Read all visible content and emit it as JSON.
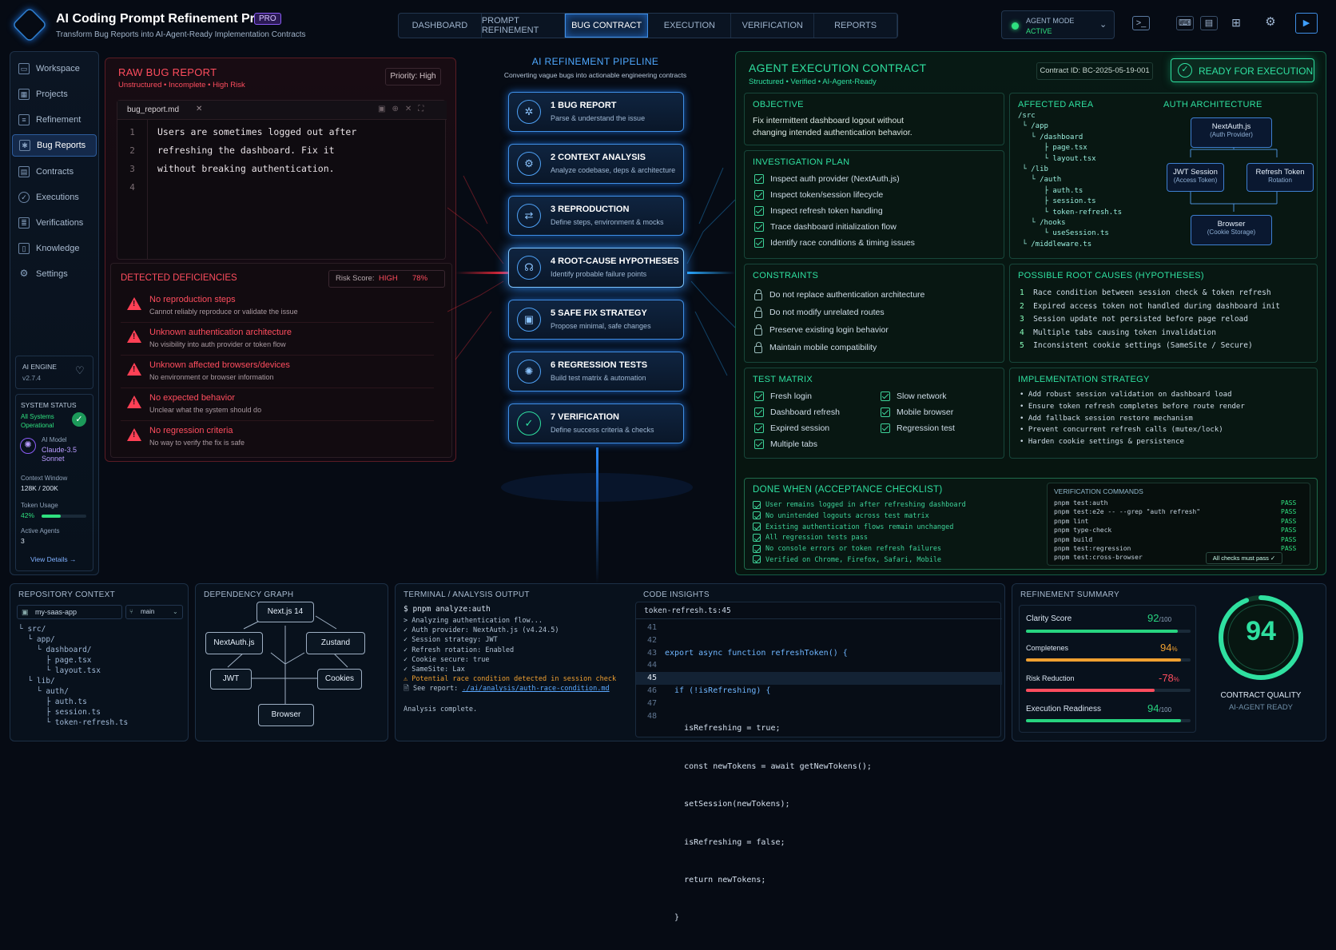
{
  "app": {
    "title": "AI Coding Prompt Refinement Pro",
    "badge": "PRO",
    "subtitle": "Transform Bug Reports into AI-Agent-Ready Implementation Contracts"
  },
  "tabs": [
    "DASHBOARD",
    "PROMPT REFINEMENT",
    "BUG CONTRACT",
    "EXECUTION",
    "VERIFICATION",
    "REPORTS"
  ],
  "agent_mode": {
    "label": "AGENT MODE",
    "status": "ACTIVE"
  },
  "sidebar": {
    "items": [
      "Workspace",
      "Projects",
      "Refinement",
      "Bug Reports",
      "Contracts",
      "Executions",
      "Verifications",
      "Knowledge",
      "Settings"
    ],
    "engine_label": "AI ENGINE",
    "engine_version": "v2.7.4",
    "status_title": "SYSTEM STATUS",
    "status_text": "All Systems Operational",
    "model_label": "AI Model",
    "model_name": "Claude-3.5 Sonnet",
    "ctx_label": "Context Window",
    "ctx_value": "128K / 200K",
    "token_label": "Token Usage",
    "token_value": "42%",
    "token_fraction": 0.42,
    "agents_label": "Active Agents",
    "agents_value": "3",
    "view_details": "View Details →"
  },
  "raw": {
    "title": "RAW BUG REPORT",
    "tags": "Unstructured • Incomplete • High Risk",
    "priority": "Priority: High",
    "filename": "bug_report.md",
    "lines": [
      "Users are sometimes logged out after",
      "refreshing the dashboard. Fix it",
      "without breaking authentication.",
      ""
    ],
    "line_numbers": [
      "1",
      "2",
      "3",
      "4"
    ]
  },
  "deficiencies": {
    "title": "DETECTED DEFICIENCIES",
    "risk_label": "Risk Score:",
    "risk_level": "HIGH",
    "risk_pct": "78%",
    "items": [
      {
        "t": "No reproduction steps",
        "d": "Cannot reliably reproduce or validate the issue"
      },
      {
        "t": "Unknown authentication architecture",
        "d": "No visibility into auth provider or token flow"
      },
      {
        "t": "Unknown affected browsers/devices",
        "d": "No environment or browser information"
      },
      {
        "t": "No expected behavior",
        "d": "Unclear what the system should do"
      },
      {
        "t": "No regression criteria",
        "d": "No way to verify the fix is safe"
      }
    ]
  },
  "pipeline": {
    "title": "AI REFINEMENT PIPELINE",
    "subtitle": "Converting vague bugs into actionable engineering contracts",
    "steps": [
      {
        "n": "1 BUG REPORT",
        "d": "Parse & understand the issue",
        "i": "✲"
      },
      {
        "n": "2 CONTEXT ANALYSIS",
        "d": "Analyze codebase, deps & architecture",
        "i": "⚙"
      },
      {
        "n": "3 REPRODUCTION",
        "d": "Define steps, environment & mocks",
        "i": "⇄"
      },
      {
        "n": "4 ROOT-CAUSE HYPOTHESES",
        "d": "Identify probable failure points",
        "i": "☊"
      },
      {
        "n": "5 SAFE FIX STRATEGY",
        "d": "Propose minimal, safe changes",
        "i": "▣"
      },
      {
        "n": "6 REGRESSION TESTS",
        "d": "Build test matrix & automation",
        "i": "✺"
      },
      {
        "n": "7 VERIFICATION",
        "d": "Define success criteria & checks",
        "i": "✓"
      }
    ]
  },
  "contract": {
    "title": "AGENT EXECUTION CONTRACT",
    "tags": "Structured • Verified • AI-Agent-Ready",
    "id": "Contract ID:  BC-2025-05-19-001",
    "ready": "READY FOR EXECUTION",
    "objective_title": "OBJECTIVE",
    "objective": [
      "Fix intermittent dashboard logout without",
      "changing intended authentication behavior."
    ],
    "plan_title": "INVESTIGATION PLAN",
    "plan": [
      "Inspect auth provider (NextAuth.js)",
      "Inspect token/session lifecycle",
      "Inspect refresh token handling",
      "Trace dashboard initialization flow",
      "Identify race conditions & timing issues"
    ],
    "constraints_title": "CONSTRAINTS",
    "constraints": [
      "Do not replace authentication architecture",
      "Do not modify unrelated routes",
      "Preserve existing login behavior",
      "Maintain mobile compatibility"
    ],
    "matrix_title": "TEST MATRIX",
    "matrix_left": [
      "Fresh login",
      "Dashboard refresh",
      "Expired session",
      "Multiple tabs"
    ],
    "matrix_right": [
      "Slow network",
      "Mobile browser",
      "Regression test"
    ],
    "affected_title": "AFFECTED AREA",
    "affected_tree": "/src\n └ /app\n   └ /dashboard\n      ├ page.tsx\n      └ layout.tsx\n └ /lib\n   └ /auth\n      ├ auth.ts\n      ├ session.ts\n      └ token-refresh.ts\n   └ /hooks\n      └ useSession.ts\n └ /middleware.ts",
    "arch_title": "AUTH ARCHITECTURE",
    "arch": {
      "a": "NextAuth.js",
      "a2": "(Auth Provider)",
      "b": "JWT Session",
      "b2": "(Access Token)",
      "c": "Refresh Token",
      "c2": "Rotation",
      "d": "Browser",
      "d2": "(Cookie Storage)"
    },
    "causes_title": "POSSIBLE ROOT CAUSES (HYPOTHESES)",
    "causes": [
      "Race condition between session check & token refresh",
      "Expired access token not handled during dashboard init",
      "Session update not persisted before page reload",
      "Multiple tabs causing token invalidation",
      "Inconsistent cookie settings (SameSite / Secure)"
    ],
    "strategy_title": "IMPLEMENTATION STRATEGY",
    "strategy": [
      "Add robust session validation on dashboard load",
      "Ensure token refresh completes before route render",
      "Add fallback session restore mechanism",
      "Prevent concurrent refresh calls (mutex/lock)",
      "Harden cookie settings & persistence"
    ],
    "done_title": "DONE WHEN (ACCEPTANCE CHECKLIST)",
    "done": [
      "User remains logged in after refreshing dashboard",
      "No unintended logouts across test matrix",
      "Existing authentication flows remain unchanged",
      "All regression tests pass",
      "No console errors or token refresh failures",
      "Verified on Chrome, Firefox, Safari, Mobile"
    ],
    "verify_title": "VERIFICATION COMMANDS",
    "verify": [
      "pnpm test:auth",
      "pnpm test:e2e -- --grep \"auth refresh\"",
      "pnpm lint",
      "pnpm type-check",
      "pnpm build",
      "pnpm test:regression",
      "pnpm test:cross-browser"
    ],
    "pass": "PASS",
    "all_pass": "All checks must pass ✓"
  },
  "repo": {
    "title": "REPOSITORY CONTEXT",
    "repo_name": "my-saas-app",
    "branch": "main",
    "tree": "└ src/\n  └ app/\n    └ dashboard/\n      ├ page.tsx\n      └ layout.tsx\n  └ lib/\n    └ auth/\n      ├ auth.ts\n      ├ session.ts\n      └ token-refresh.ts"
  },
  "dep": {
    "title": "DEPENDENCY GRAPH",
    "nodes": [
      "Next.js 14",
      "NextAuth.js",
      "Zustand",
      "JWT",
      "Cookies",
      "Browser"
    ]
  },
  "terminal": {
    "title": "TERMINAL / ANALYSIS OUTPUT",
    "cmd": "$ pnpm analyze:auth",
    "lines": [
      "> Analyzing authentication flow...",
      "✓ Auth provider: NextAuth.js (v4.24.5)",
      "✓ Session strategy: JWT",
      "✓ Refresh rotation: Enabled",
      "✓ Cookie secure: true",
      "✓ SameSite: Lax",
      "⚠ Potential race condition detected in session check"
    ],
    "report_label": "🗎 See report: ",
    "report_link": "./ai/analysis/auth-race-condition.md",
    "done": "Analysis complete."
  },
  "insights": {
    "title": "CODE INSIGHTS",
    "file": "token-refresh.ts:45",
    "nums": [
      "41",
      "42",
      "43",
      "44",
      "45",
      "46",
      "47",
      "48"
    ],
    "code": [
      "export async function refreshToken() {",
      "  if (!isRefreshing) {",
      "    isRefreshing = true;",
      "    const newTokens = await getNewTokens();",
      "    setSession(newTokens);",
      "    isRefreshing = false;",
      "    return newTokens;",
      "  }"
    ]
  },
  "summary": {
    "title": "REFINEMENT SUMMARY",
    "metrics": [
      {
        "l": "Clarity Score",
        "v": "92",
        "u": "/100",
        "f": 0.92,
        "c": "#27d47f"
      },
      {
        "l": "Completenes",
        "v": "94",
        "u": "%",
        "f": 0.94,
        "c": "#f0a030"
      },
      {
        "l": "Risk Reduction",
        "v": "-78",
        "u": "%",
        "f": 0.78,
        "c": "#ff4d5e"
      },
      {
        "l": "Execution Readiness",
        "v": "94",
        "u": "/100",
        "f": 0.94,
        "c": "#27d47f"
      }
    ],
    "score": "94",
    "score_label": "CONTRACT QUALITY",
    "score_sub": "AI-AGENT READY",
    "score_fraction": 0.94
  },
  "colors": {
    "accent": "#3f8fe6",
    "danger": "#ff4d5e",
    "success": "#2fe0a0"
  }
}
